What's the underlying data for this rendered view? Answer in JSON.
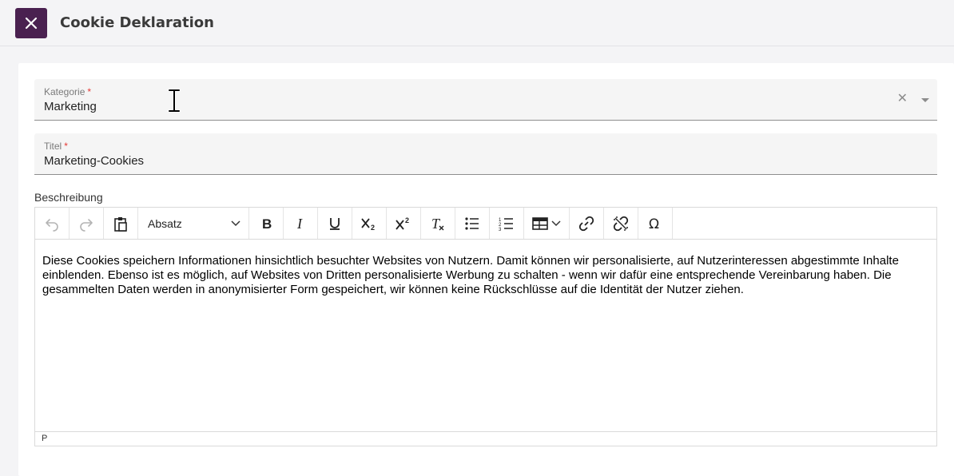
{
  "header": {
    "title": "Cookie Deklaration",
    "close_icon": "close-icon",
    "accent_color": "#4a2150"
  },
  "form": {
    "category": {
      "label": "Kategorie",
      "required_mark": "*",
      "value": "Marketing"
    },
    "title": {
      "label": "Titel",
      "required_mark": "*",
      "value": "Marketing-Cookies"
    },
    "description": {
      "label": "Beschreibung",
      "toolbar": {
        "block_format": "Absatz",
        "buttons": [
          "undo-icon",
          "redo-icon",
          "paste-icon",
          "bold-icon",
          "italic-icon",
          "underline-icon",
          "subscript-icon",
          "superscript-icon",
          "clear-format-icon",
          "bullet-list-icon",
          "numbered-list-icon",
          "table-icon",
          "link-icon",
          "unlink-icon",
          "omega-icon"
        ]
      },
      "content": "Diese Cookies speichern Informationen hinsichtlich besuchter Websites von Nutzern. Damit können wir personalisierte, auf Nutzerinteressen abgestimmte Inhalte einblenden. Ebenso ist es möglich, auf Websites von Dritten personalisierte Werbung zu schalten - wenn wir dafür eine entsprechende Vereinbarung haben. Die gesammelten Daten werden in anonymisierter Form gespeichert, wir können keine Rückschlüsse auf die Identität der Nutzer ziehen.",
      "status_path": "P"
    }
  }
}
